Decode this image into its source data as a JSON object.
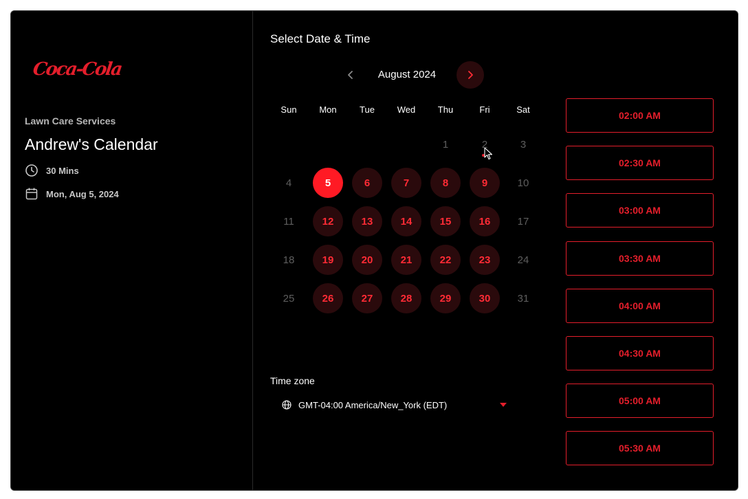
{
  "brand": {
    "logo_text": "Coca-Cola"
  },
  "left": {
    "service": "Lawn Care Services",
    "title": "Andrew's Calendar",
    "duration": "30 Mins",
    "date": "Mon, Aug 5, 2024"
  },
  "main": {
    "title": "Select Date & Time",
    "month_label": "August 2024",
    "weekdays": [
      "Sun",
      "Mon",
      "Tue",
      "Wed",
      "Thu",
      "Fri",
      "Sat"
    ],
    "weeks": [
      [
        "",
        "",
        "",
        "",
        "1",
        "2",
        "3"
      ],
      [
        "4",
        "5",
        "6",
        "7",
        "8",
        "9",
        "10"
      ],
      [
        "11",
        "12",
        "13",
        "14",
        "15",
        "16",
        "17"
      ],
      [
        "18",
        "19",
        "20",
        "21",
        "22",
        "23",
        "24"
      ],
      [
        "25",
        "26",
        "27",
        "28",
        "29",
        "30",
        "31"
      ]
    ],
    "selected_day": "5",
    "today_day": "2",
    "timezone_label": "Time zone",
    "timezone_value": "GMT-04:00 America/New_York (EDT)"
  },
  "slots": [
    "02:00 AM",
    "02:30 AM",
    "03:00 AM",
    "03:30 AM",
    "04:00 AM",
    "04:30 AM",
    "05:00 AM",
    "05:30 AM"
  ],
  "colors": {
    "accent": "#e41e2b",
    "accent_bright": "#ff1a24",
    "background": "#000000",
    "muted": "#5e5e5e"
  }
}
